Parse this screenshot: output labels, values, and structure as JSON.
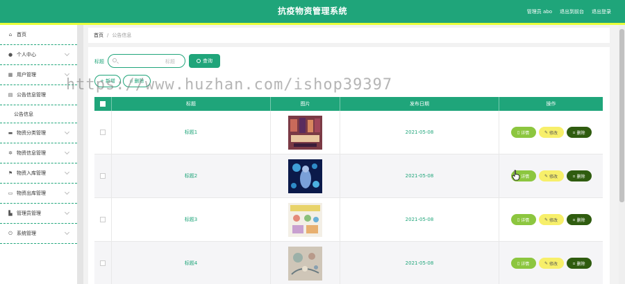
{
  "header": {
    "title": "抗疫物资管理系统",
    "user": "管理员 abo",
    "back_to_front": "退出到前台",
    "logout": "退出登录"
  },
  "sidebar": {
    "items": [
      {
        "label": "首页",
        "icon": "home-icon",
        "chevron": false
      },
      {
        "label": "个人中心",
        "icon": "user-icon",
        "chevron": true
      },
      {
        "label": "用户管理",
        "icon": "table-icon",
        "chevron": true
      },
      {
        "label": "公告信息管理",
        "icon": "notice-icon",
        "chevron": false
      },
      {
        "label": "公告信息",
        "icon": "",
        "chevron": false,
        "sub": true
      },
      {
        "label": "物资分类管理",
        "icon": "box-icon",
        "chevron": true
      },
      {
        "label": "物资信息管理",
        "icon": "gear-icon",
        "chevron": true
      },
      {
        "label": "物资入库管理",
        "icon": "flag-icon",
        "chevron": true
      },
      {
        "label": "物资出库管理",
        "icon": "chat-icon",
        "chevron": true
      },
      {
        "label": "管理员管理",
        "icon": "chart-icon",
        "chevron": true
      },
      {
        "label": "系统管理",
        "icon": "power-icon",
        "chevron": true
      }
    ]
  },
  "breadcrumb": {
    "home": "首页",
    "separator": "/",
    "current": "公告信息"
  },
  "search": {
    "label": "标题",
    "placeholder": "标题",
    "button": "查询"
  },
  "actions": {
    "add": "新增",
    "delete": "删除"
  },
  "table": {
    "columns": [
      "标题",
      "图片",
      "发布日期",
      "操作"
    ],
    "rows": [
      {
        "title": "标题1",
        "date": "2021-05-08",
        "image": "poster-image"
      },
      {
        "title": "标题2",
        "date": "2021-05-08",
        "image": "virus-image"
      },
      {
        "title": "标题3",
        "date": "2021-05-08",
        "image": "drawing-image"
      },
      {
        "title": "标题4",
        "date": "2021-05-08",
        "image": "sketch-image"
      }
    ],
    "op_detail": "详情",
    "op_edit": "修改",
    "op_delete": "删除"
  },
  "watermark": "https://www.huzhan.com/ishop39397",
  "colors": {
    "primary": "#1fa57a",
    "accent_line": "#e8ff3a",
    "detail": "#8cc63f",
    "edit": "#f7ef6a",
    "delete": "#2f5c0f"
  }
}
